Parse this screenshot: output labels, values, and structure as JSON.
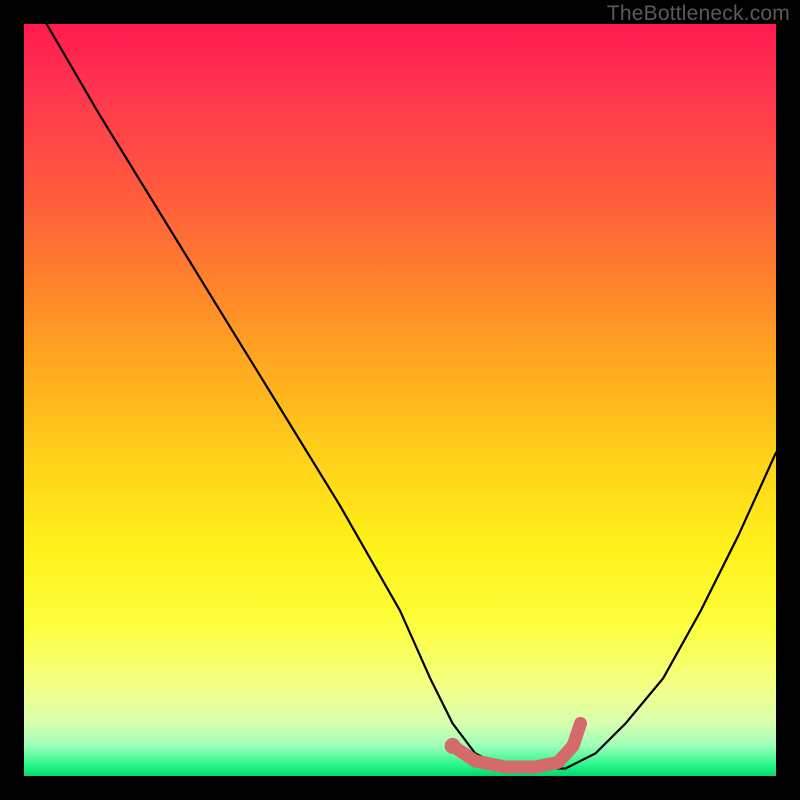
{
  "watermark": "TheBottleneck.com",
  "chart_data": {
    "type": "line",
    "title": "",
    "xlabel": "",
    "ylabel": "",
    "xlim": [
      0,
      100
    ],
    "ylim": [
      0,
      100
    ],
    "series": [
      {
        "name": "bottleneck-curve",
        "color": "#000000",
        "x": [
          3,
          10,
          18,
          26,
          34,
          42,
          50,
          54,
          57,
          60,
          64,
          68,
          72,
          76,
          80,
          85,
          90,
          95,
          100
        ],
        "y": [
          100,
          88,
          75,
          62,
          49,
          36,
          22,
          13,
          7,
          3,
          1,
          1,
          1,
          3,
          7,
          13,
          22,
          32,
          43
        ]
      },
      {
        "name": "highlight-band",
        "color": "#d46a6a",
        "x": [
          57,
          60,
          64,
          68,
          71,
          73,
          74
        ],
        "y": [
          4,
          2,
          1.2,
          1.2,
          1.8,
          4,
          7
        ]
      }
    ],
    "highlight_point": {
      "x": 57,
      "y": 4
    },
    "background_gradient": {
      "stops": [
        {
          "pos": 0,
          "color": "#ff1a4d"
        },
        {
          "pos": 45,
          "color": "#ffa81f"
        },
        {
          "pos": 70,
          "color": "#fff21a"
        },
        {
          "pos": 96,
          "color": "#9cffb8"
        },
        {
          "pos": 100,
          "color": "#00d86e"
        }
      ]
    }
  }
}
